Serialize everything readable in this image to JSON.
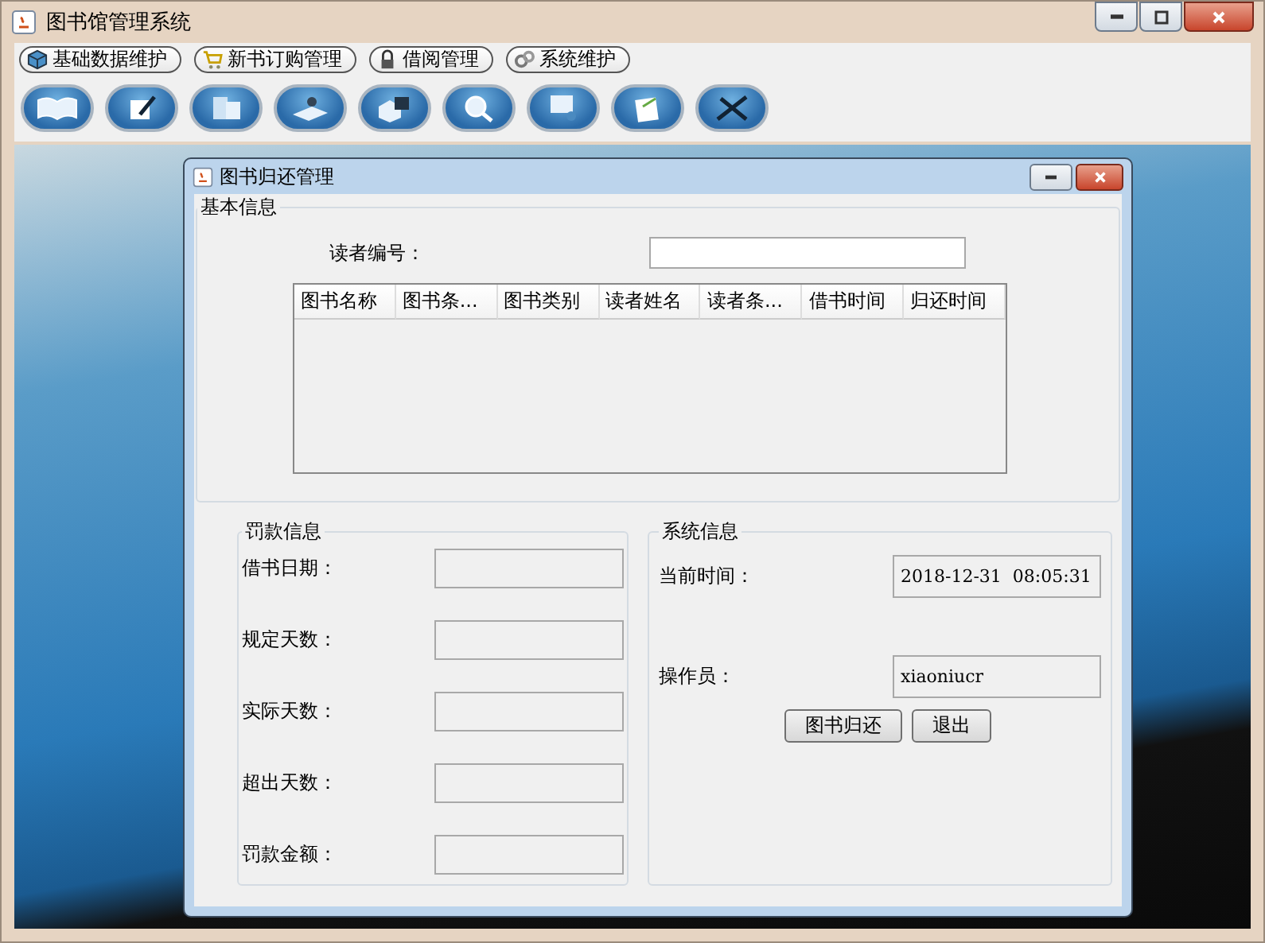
{
  "window": {
    "title": "图书馆管理系统"
  },
  "menu": [
    {
      "label": "基础数据维护"
    },
    {
      "label": "新书订购管理"
    },
    {
      "label": "借阅管理"
    },
    {
      "label": "系统维护"
    }
  ],
  "dialog": {
    "title": "图书归还管理",
    "basic_info": {
      "legend": "基本信息",
      "reader_id": {
        "label": "读者编号："
      },
      "table": {
        "columns": [
          "图书名称",
          "图书条...",
          "图书类别",
          "读者姓名",
          "读者条...",
          "借书时间",
          "归还时间"
        ]
      }
    },
    "fine_info": {
      "legend": "罚款信息",
      "fields": [
        {
          "label": "借书日期："
        },
        {
          "label": "规定天数："
        },
        {
          "label": "实际天数："
        },
        {
          "label": "超出天数："
        },
        {
          "label": "罚款金额："
        }
      ]
    },
    "system_info": {
      "legend": "系统信息",
      "fields": [
        {
          "label": "当前时间：",
          "value": "2018-12-31  08:05:31"
        },
        {
          "label": "操作员：",
          "value": "xiaoniucr"
        }
      ],
      "buttons": [
        "图书归还",
        "退出"
      ]
    }
  }
}
